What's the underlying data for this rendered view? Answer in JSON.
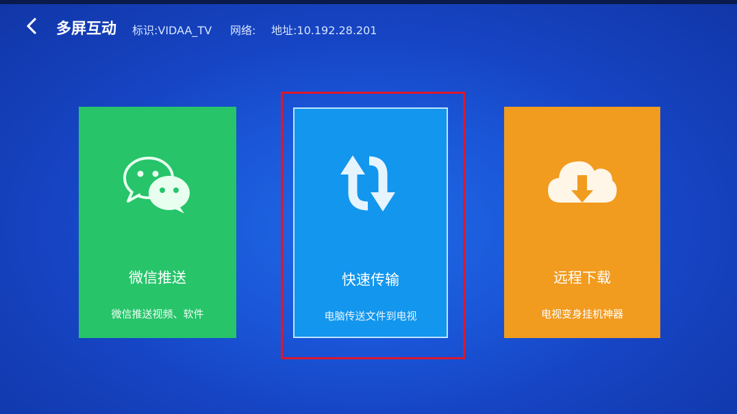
{
  "header": {
    "title": "多屏互动",
    "device_id": "标识:VIDAA_TV",
    "network": "网络:",
    "address": "地址:10.192.28.201"
  },
  "cards": [
    {
      "label": "微信推送",
      "subtitle": "微信推送视频、软件",
      "icon": "wechat-icon",
      "color": "#27c46a",
      "focused": false
    },
    {
      "label": "快速传输",
      "subtitle": "电脑传送文件到电视",
      "icon": "transfer-arrows-icon",
      "color": "#1296ee",
      "focused": true
    },
    {
      "label": "远程下载",
      "subtitle": "电视变身挂机神器",
      "icon": "cloud-download-icon",
      "color": "#f19b1f",
      "focused": false
    }
  ],
  "focus_color": "#e0162b"
}
